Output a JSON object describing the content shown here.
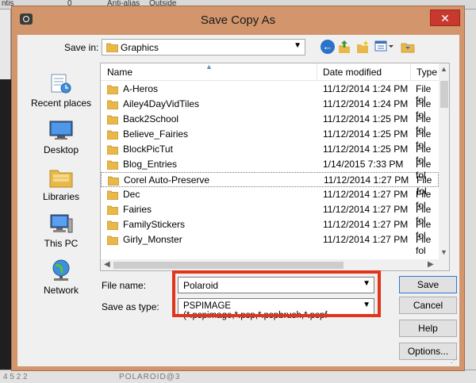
{
  "background": {
    "top_texts": [
      "ntis",
      "0",
      "Anti-alias",
      "Outside"
    ],
    "bottom_texts": [
      "4 5 2 2",
      "POLAROID@3"
    ]
  },
  "dialog": {
    "title": "Save Copy As",
    "close_glyph": "✕",
    "save_in_label": "Save in:",
    "save_in_value": "Graphics",
    "places": [
      {
        "label": "Recent places",
        "icon": "recent-places-icon"
      },
      {
        "label": "Desktop",
        "icon": "desktop-icon"
      },
      {
        "label": "Libraries",
        "icon": "libraries-icon"
      },
      {
        "label": "This PC",
        "icon": "this-pc-icon"
      },
      {
        "label": "Network",
        "icon": "network-icon"
      }
    ],
    "columns": {
      "name": "Name",
      "date": "Date modified",
      "type": "Type"
    },
    "files": [
      {
        "name": "A-Heros",
        "date": "11/12/2014 1:24 PM",
        "type": "File fol"
      },
      {
        "name": "Ailey4DayVidTiles",
        "date": "11/12/2014 1:24 PM",
        "type": "File fol"
      },
      {
        "name": "Back2School",
        "date": "11/12/2014 1:25 PM",
        "type": "File fol"
      },
      {
        "name": "Believe_Fairies",
        "date": "11/12/2014 1:25 PM",
        "type": "File fol"
      },
      {
        "name": "BlockPicTut",
        "date": "11/12/2014 1:25 PM",
        "type": "File fol"
      },
      {
        "name": "Blog_Entries",
        "date": "1/14/2015 7:33 PM",
        "type": "File fol"
      },
      {
        "name": "Corel Auto-Preserve",
        "date": "11/12/2014 1:27 PM",
        "type": "File fol"
      },
      {
        "name": "Dec",
        "date": "11/12/2014 1:27 PM",
        "type": "File fol"
      },
      {
        "name": "Fairies",
        "date": "11/12/2014 1:27 PM",
        "type": "File fol"
      },
      {
        "name": "FamilyStickers",
        "date": "11/12/2014 1:27 PM",
        "type": "File fol"
      },
      {
        "name": "Girly_Monster",
        "date": "11/12/2014 1:27 PM",
        "type": "File fol"
      }
    ],
    "selected_index": 6,
    "file_name_label": "File name:",
    "file_name_value": "Polaroid",
    "save_type_label": "Save as type:",
    "save_type_value": "PSPIMAGE (*.pspimage,*.psp,*.pspbrush,*.pspf",
    "buttons": {
      "save": "Save",
      "cancel": "Cancel",
      "help": "Help",
      "options": "Options..."
    },
    "accent_colors": {
      "title_bar": "#d2956c",
      "highlight": "#e0341c",
      "folder": "#e8b84a"
    }
  }
}
